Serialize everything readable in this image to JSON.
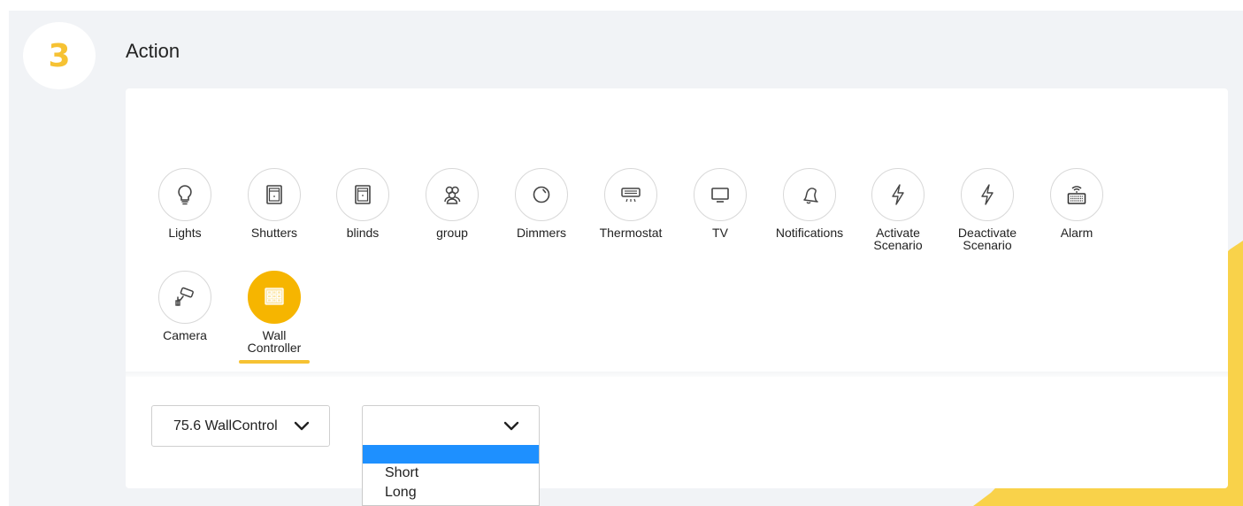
{
  "step": {
    "number": "3",
    "title": "Action"
  },
  "colors": {
    "accent": "#f6c233",
    "selected_fill": "#f6b500",
    "highlight": "#1e90ff",
    "background": "#f1f3f6"
  },
  "actions": [
    {
      "label": "Lights",
      "icon": "lightbulb-icon",
      "selected": false
    },
    {
      "label": "Shutters",
      "icon": "shutters-icon",
      "selected": false
    },
    {
      "label": "blinds",
      "icon": "blinds-icon",
      "selected": false
    },
    {
      "label": "group",
      "icon": "group-icon",
      "selected": false
    },
    {
      "label": "Dimmers",
      "icon": "dimmer-icon",
      "selected": false
    },
    {
      "label": "Thermostat",
      "icon": "air-conditioner-icon",
      "selected": false
    },
    {
      "label": "TV",
      "icon": "tv-icon",
      "selected": false
    },
    {
      "label": "Notifications",
      "icon": "bell-icon",
      "selected": false
    },
    {
      "label": "Activate\nScenario",
      "icon": "lightning-icon",
      "selected": false
    },
    {
      "label": "Deactivate\nScenario",
      "icon": "lightning-icon",
      "selected": false
    },
    {
      "label": "Alarm",
      "icon": "alarm-keypad-icon",
      "selected": false
    },
    {
      "label": "Camera",
      "icon": "security-camera-icon",
      "selected": false
    },
    {
      "label": "Wall\nController",
      "icon": "wall-controller-icon",
      "selected": true
    }
  ],
  "device_select": {
    "value": "75.6 WallControl"
  },
  "press_select": {
    "value": "",
    "options": [
      "",
      "Short",
      "Long"
    ],
    "highlighted_option": ""
  }
}
